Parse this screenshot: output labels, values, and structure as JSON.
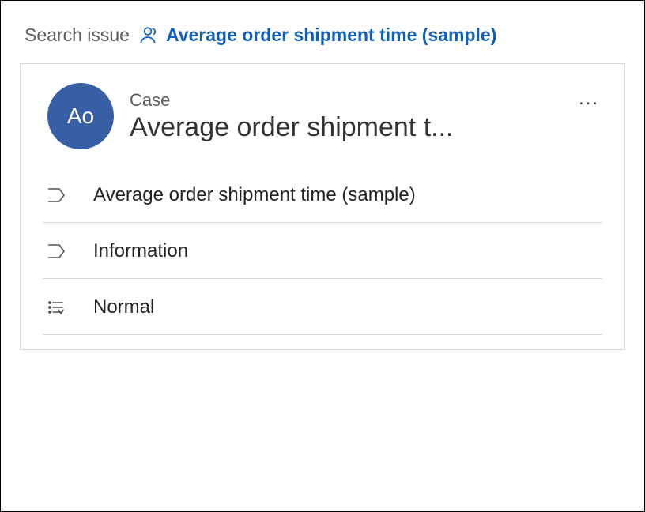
{
  "breadcrumb": {
    "root": "Search issue",
    "current": "Average order shipment time (sample)"
  },
  "card": {
    "avatar_initials": "Ao",
    "record_type": "Case",
    "record_title_truncated": "Average order shipment t...",
    "more_label": "..."
  },
  "rows": [
    {
      "icon": "tag",
      "text": "Average order shipment time (sample)"
    },
    {
      "icon": "tag",
      "text": "Information"
    },
    {
      "icon": "priority",
      "text": "Normal"
    }
  ],
  "colors": {
    "link": "#1160b7",
    "avatar_bg": "#385fa6"
  }
}
